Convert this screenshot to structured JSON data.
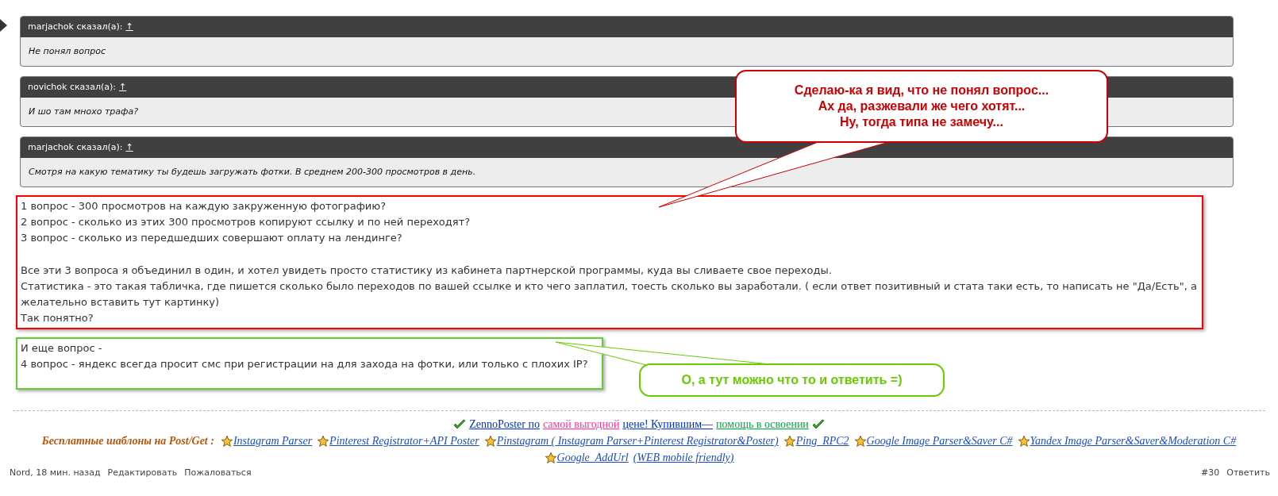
{
  "quotes": [
    {
      "author": "marjachok сказал(а):",
      "arrow": "↑",
      "text": "Не понял вопрос"
    },
    {
      "author": "novichok сказал(а):",
      "arrow": "↑",
      "text": "И шо там мнохо трафа?"
    },
    {
      "author": "marjachok сказал(а):",
      "arrow": "↑",
      "text": "Смотря на какую тематику ты будешь загружать фотки. В среднем 200-300 просмотров в день."
    }
  ],
  "post_boxes": [
    {
      "color": "#ff0000",
      "paragraphs": [
        [
          "1 вопрос - 300 просмотров на каждую закруженную фотографию?",
          "2 вопрос - сколько из этих 300 просмотров копируют ссылку и по ней переходят?",
          "3 вопрос - сколько из передшедших совершают оплату на лендинге?"
        ],
        [
          "Все эти 3 вопроса я объединил в один, и хотел увидеть просто статистику из кабинета партнерской программы, куда вы сливаете свое переходы.",
          "Статистика - это такая табличка, где пишется сколько было переходов по вашей ссылке и кто чего заплатил, тоесть сколько вы заработали. ( если ответ позитивный и стата таки есть, то написать не \"Да/Есть\", а желательно вставить тут картинку)",
          "Так понятно?"
        ]
      ]
    },
    {
      "color": "#66cc33",
      "paragraphs": [
        [
          "И еще вопрос -",
          "4 вопрос - яндекс всегда просит смс при регистрации на для захода на фотки, или только с плохих IP?"
        ]
      ]
    }
  ],
  "callouts": [
    {
      "color": "#cc0000",
      "lines": [
        "Сделаю-ка я вид, что не понял вопрос...",
        "Ах да, разжевали же чего хотят...",
        "Ну, тогда типа не замечу..."
      ]
    },
    {
      "color": "#66cc00",
      "lines": [
        "О, а тут можно что то и ответить =)"
      ]
    }
  ],
  "signature": {
    "promo": [
      {
        "text": "ZennoPoster по",
        "color": "#0033cc"
      },
      {
        "text": "самой выгодной",
        "color": "#ff3399"
      },
      {
        "text": "цене! Купившим—",
        "color": "#0033cc"
      },
      {
        "text": "помощь в освоении",
        "color": "#00aa44"
      }
    ],
    "label": "Бесплатные шаблоны на Post/Get :",
    "links": [
      {
        "text": "Instagram Parser",
        "star": true
      },
      {
        "text": "Pinterest Registrator+API Poster",
        "star": true
      },
      {
        "text": "Pinstagram ( Instagram Parser+Pinterest Registrator&Poster)",
        "star": true
      },
      {
        "text": "Ping_RPC2",
        "star": true
      },
      {
        "text": "Google Image Parser&Saver C#",
        "star": true
      },
      {
        "text": "Yandex Image Parser&Saver&Moderation C#",
        "star": true
      },
      {
        "text": "Google_AddUrl",
        "star": true
      },
      {
        "text": "(WEB mobile friendly)",
        "star": false
      }
    ]
  },
  "footer": {
    "meta": "Nord, 18 мин. назад",
    "actions": [
      "Редактировать",
      "Пожаловаться"
    ],
    "post_number": "#30",
    "reply": "Ответить"
  }
}
